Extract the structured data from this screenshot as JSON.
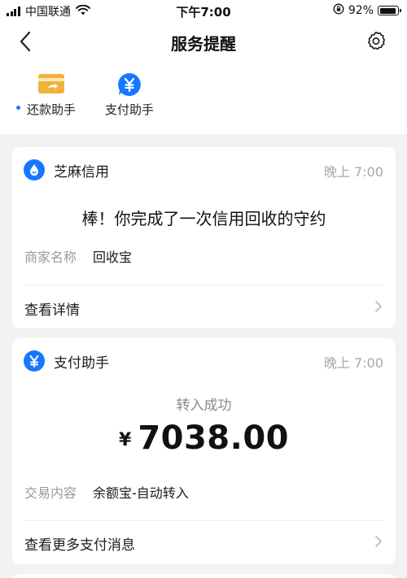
{
  "status_bar": {
    "carrier": "中国联通",
    "time": "下午7:00",
    "battery": "92%",
    "battery_level": 0.92
  },
  "nav": {
    "title": "服务提醒",
    "back_icon": "chevron-left-icon",
    "settings_icon": "gear-icon"
  },
  "helpers": [
    {
      "label": "还款助手",
      "icon": "card-repay-icon",
      "color": "#f0b23a",
      "has_dot": true
    },
    {
      "label": "支付助手",
      "icon": "yuan-chat-icon",
      "color": "#1677ff",
      "has_dot": false
    }
  ],
  "colors": {
    "accent": "#1677ff",
    "muted": "#a8a8a8",
    "background": "#f2f2f2"
  },
  "cards": [
    {
      "source": "芝麻信用",
      "time": "晚上 7:00",
      "headline": "棒！你完成了一次信用回收的守约",
      "rows": [
        {
          "label": "商家名称",
          "value": "回收宝"
        }
      ],
      "link": "查看详情"
    },
    {
      "source": "支付助手",
      "time": "晚上 7:00",
      "status": "转入成功",
      "currency": "¥",
      "amount": "7038.00",
      "rows": [
        {
          "label": "交易内容",
          "value": "余额宝-自动转入"
        }
      ],
      "link": "查看更多支付消息"
    }
  ]
}
